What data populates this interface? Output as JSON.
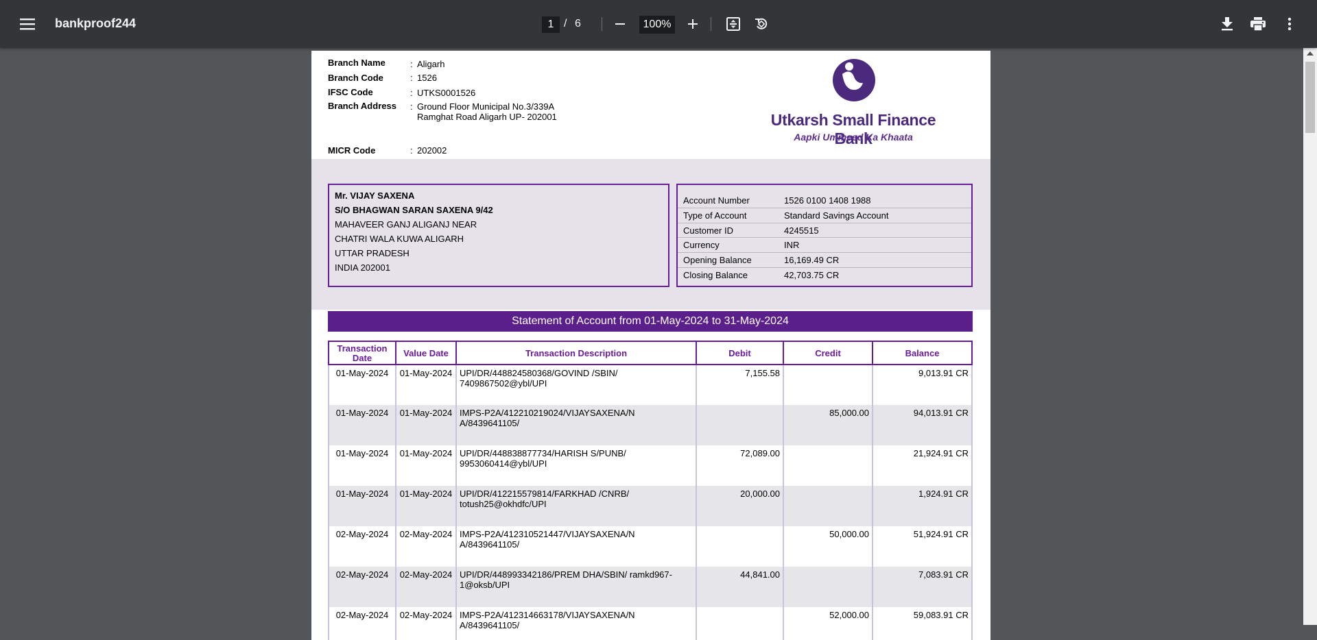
{
  "viewer": {
    "title": "bankproof244",
    "current_page": "1",
    "page_separator": "/",
    "total_pages": "6",
    "zoom": "100%"
  },
  "branch": {
    "name_label": "Branch Name",
    "name_value": "Aligarh",
    "code_label": "Branch Code",
    "code_value": "1526",
    "ifsc_label": "IFSC Code",
    "ifsc_value": "UTKS0001526",
    "address_label": "Branch Address",
    "address_line1": "Ground Floor Municipal  No.3/339A",
    "address_line2": "Ramghat Road Aligarh UP- 202001",
    "micr_label": "MICR Code",
    "micr_value": "202002",
    "colon": ":"
  },
  "bank": {
    "name": "Utkarsh Small Finance Bank",
    "tagline": "Aapki Ummeed Ka Khaata",
    "brand_color": "#5b2d8e"
  },
  "customer": {
    "lines": [
      "Mr. VIJAY  SAXENA",
      "S/O BHAGWAN SARAN SAXENA 9/42",
      "MAHAVEER GANJ ALIGANJ NEAR",
      "CHATRI WALA KUWA ALIGARH",
      "UTTAR PRADESH",
      "INDIA 202001"
    ]
  },
  "account": {
    "rows": [
      {
        "label": "Account Number",
        "value": "1526 0100 1408 1988"
      },
      {
        "label": "Type of Account",
        "value": "Standard Savings Account"
      },
      {
        "label": "Customer ID",
        "value": "4245515"
      },
      {
        "label": "Currency",
        "value": "INR"
      },
      {
        "label": "Opening Balance",
        "value": "16,169.49 CR"
      },
      {
        "label": "Closing Balance",
        "value": "42,703.75 CR"
      }
    ]
  },
  "statement": {
    "title": "Statement of Account from  01-May-2024  to  31-May-2024",
    "headers": {
      "txn_date_1": "Transaction",
      "txn_date_2": "Date",
      "value_date": "Value Date",
      "description": "Transaction Description",
      "debit": "Debit",
      "credit": "Credit",
      "balance": "Balance"
    },
    "rows": [
      {
        "txn_date": "01-May-2024",
        "value_date": "01-May-2024",
        "desc1": "UPI/DR/448824580368/GOVIND  /SBIN/",
        "desc2": "7409867502@ybl/UPI",
        "debit": "7,155.58",
        "credit": "",
        "balance": "9,013.91 CR"
      },
      {
        "txn_date": "01-May-2024",
        "value_date": "01-May-2024",
        "desc1": "IMPS-P2A/412210219024/VIJAYSAXENA/N",
        "desc2": "A/8439641105/",
        "debit": "",
        "credit": "85,000.00",
        "balance": "94,013.91 CR"
      },
      {
        "txn_date": "01-May-2024",
        "value_date": "01-May-2024",
        "desc1": "UPI/DR/448838877734/HARISH S/PUNB/",
        "desc2": "9953060414@ybl/UPI",
        "debit": "72,089.00",
        "credit": "",
        "balance": "21,924.91 CR"
      },
      {
        "txn_date": "01-May-2024",
        "value_date": "01-May-2024",
        "desc1": "UPI/DR/412215579814/FARKHAD /CNRB/",
        "desc2": "totush25@okhdfc/UPI",
        "debit": "20,000.00",
        "credit": "",
        "balance": "1,924.91 CR"
      },
      {
        "txn_date": "02-May-2024",
        "value_date": "02-May-2024",
        "desc1": "IMPS-P2A/412310521447/VIJAYSAXENA/N",
        "desc2": "A/8439641105/",
        "debit": "",
        "credit": "50,000.00",
        "balance": "51,924.91 CR"
      },
      {
        "txn_date": "02-May-2024",
        "value_date": "02-May-2024",
        "desc1": "UPI/DR/448993342186/PREM DHA/SBIN/ ramkd967-",
        "desc2": "1@oksb/UPI",
        "debit": "44,841.00",
        "credit": "",
        "balance": "7,083.91 CR"
      },
      {
        "txn_date": "02-May-2024",
        "value_date": "02-May-2024",
        "desc1": "IMPS-P2A/412314663178/VIJAYSAXENA/N",
        "desc2": "A/8439641105/",
        "debit": "",
        "credit": "52,000.00",
        "balance": "59,083.91 CR"
      }
    ]
  },
  "icons": {
    "menu": "menu-icon",
    "zoom_out": "minus-icon",
    "zoom_in": "plus-icon",
    "fit": "fit-page-icon",
    "rotate": "rotate-icon",
    "download": "download-icon",
    "print": "print-icon",
    "more": "more-vert-icon"
  }
}
